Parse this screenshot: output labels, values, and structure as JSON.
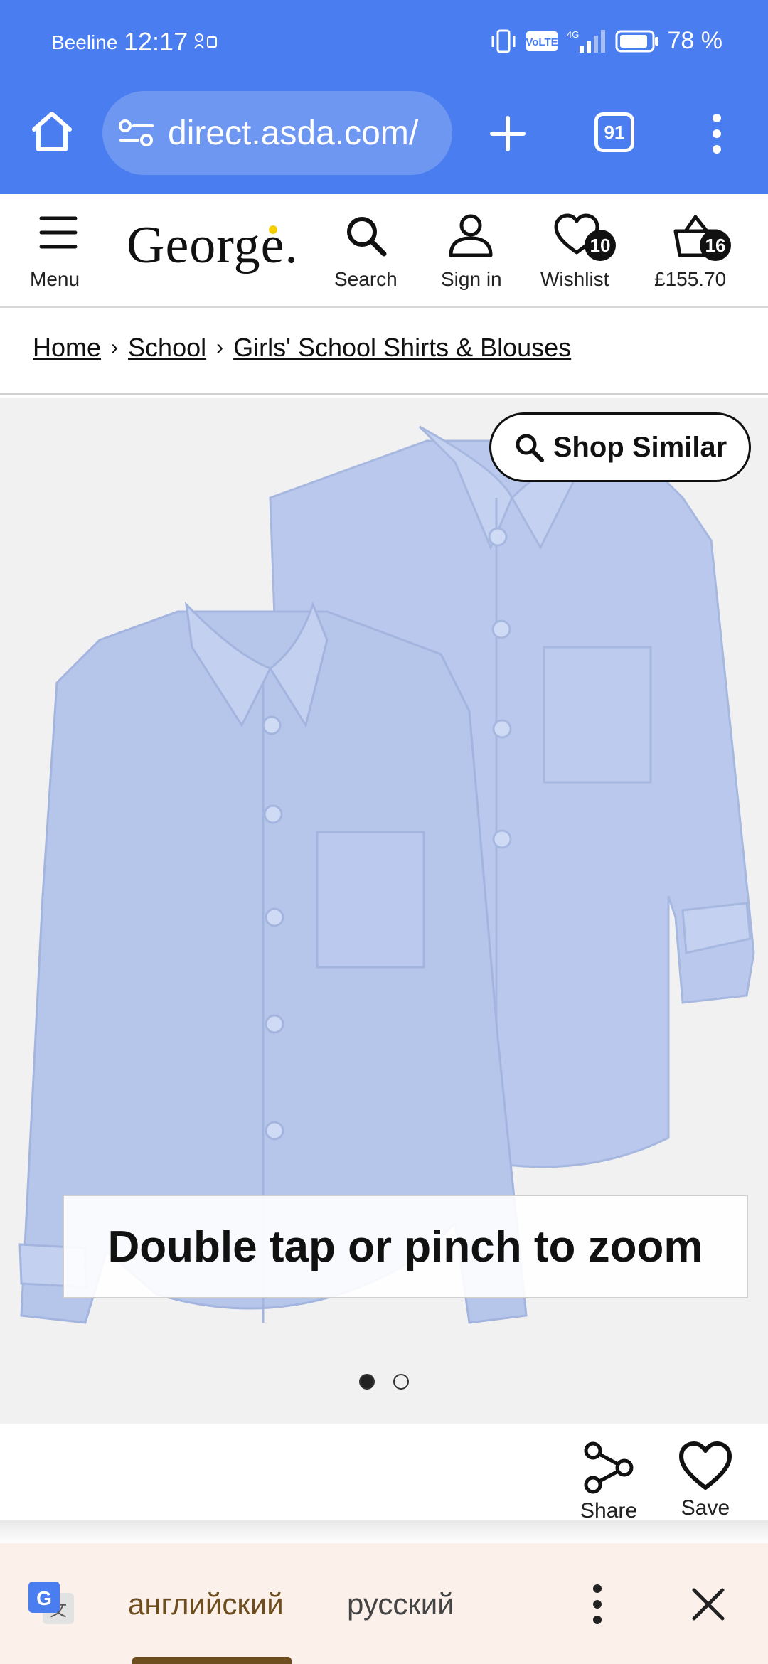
{
  "status_bar": {
    "carrier": "Beeline",
    "time": "12:17",
    "battery": "78 %",
    "network": "4G",
    "volte": "VoLTE"
  },
  "browser": {
    "url": "direct.asda.com/",
    "tab_count": "91"
  },
  "header": {
    "menu_label": "Menu",
    "logo": "George.",
    "search_label": "Search",
    "signin_label": "Sign in",
    "wishlist_label": "Wishlist",
    "wishlist_count": "10",
    "basket_total": "£155.70",
    "basket_count": "16"
  },
  "breadcrumb": {
    "items": [
      "Home",
      "School",
      "Girls' School Shirts & Blouses"
    ],
    "separator": "›"
  },
  "product": {
    "shop_similar_label": "Shop Similar",
    "zoom_hint": "Double tap or pinch to zoom",
    "image_count": 2,
    "active_image": 1
  },
  "actions": {
    "share_label": "Share",
    "save_label": "Save"
  },
  "translate_bar": {
    "source_lang": "английский",
    "target_lang": "русский"
  },
  "colors": {
    "chrome": "#4a7def",
    "pill": "#6e97f2",
    "shirt": "#b9c8ec",
    "translate_accent": "#6e4d1e"
  }
}
